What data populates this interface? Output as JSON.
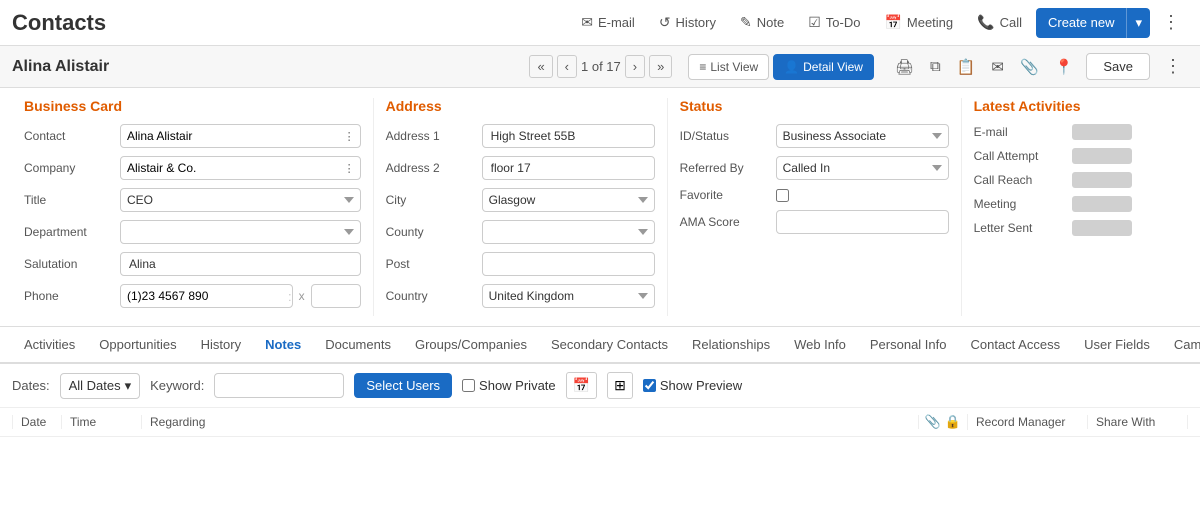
{
  "app": {
    "title": "Contacts"
  },
  "topnav": {
    "email": "E-mail",
    "history": "History",
    "note": "Note",
    "todo": "To-Do",
    "meeting": "Meeting",
    "call": "Call",
    "create_new": "Create new",
    "more_icon": "⋮"
  },
  "record_bar": {
    "name": "Alina Alistair",
    "nav_first": "«",
    "nav_prev": "‹",
    "count": "1 of 17",
    "nav_next": "›",
    "nav_last": "»",
    "list_view": "List View",
    "detail_view": "Detail View",
    "save": "Save",
    "more": "⋮"
  },
  "business_card": {
    "title": "Business Card",
    "fields": [
      {
        "label": "Contact",
        "value": "Alina Alistair",
        "type": "input-btn"
      },
      {
        "label": "Company",
        "value": "Alistair & Co.",
        "type": "input-btn"
      },
      {
        "label": "Title",
        "value": "CEO",
        "type": "select"
      },
      {
        "label": "Department",
        "value": "",
        "type": "select"
      },
      {
        "label": "Salutation",
        "value": "Alina",
        "type": "input"
      },
      {
        "label": "Phone",
        "value": "(1)23 4567 890",
        "type": "phone"
      }
    ]
  },
  "address": {
    "title": "Address",
    "fields": [
      {
        "label": "Address 1",
        "value": "High Street 55B",
        "type": "input"
      },
      {
        "label": "Address 2",
        "value": "floor 17",
        "type": "input"
      },
      {
        "label": "City",
        "value": "Glasgow",
        "type": "select"
      },
      {
        "label": "County",
        "value": "",
        "type": "select"
      },
      {
        "label": "Post",
        "value": "",
        "type": "input"
      },
      {
        "label": "Country",
        "value": "United Kingdom",
        "type": "select"
      }
    ]
  },
  "status": {
    "title": "Status",
    "fields": [
      {
        "label": "ID/Status",
        "value": "Business Associate",
        "type": "select"
      },
      {
        "label": "Referred By",
        "value": "Called In",
        "type": "select"
      },
      {
        "label": "Favorite",
        "value": "",
        "type": "checkbox"
      },
      {
        "label": "AMA Score",
        "value": "",
        "type": "input"
      }
    ]
  },
  "latest_activities": {
    "title": "Latest Activities",
    "items": [
      {
        "label": "E-mail"
      },
      {
        "label": "Call Attempt"
      },
      {
        "label": "Call Reach"
      },
      {
        "label": "Meeting"
      },
      {
        "label": "Letter Sent"
      }
    ]
  },
  "tabs": {
    "items": [
      {
        "label": "Activities",
        "active": false
      },
      {
        "label": "Opportunities",
        "active": false
      },
      {
        "label": "History",
        "active": false
      },
      {
        "label": "Notes",
        "active": true
      },
      {
        "label": "Documents",
        "active": false
      },
      {
        "label": "Groups/Companies",
        "active": false
      },
      {
        "label": "Secondary Contacts",
        "active": false
      },
      {
        "label": "Relationships",
        "active": false
      },
      {
        "label": "Web Info",
        "active": false
      },
      {
        "label": "Personal Info",
        "active": false
      },
      {
        "label": "Contact Access",
        "active": false
      },
      {
        "label": "User Fields",
        "active": false
      },
      {
        "label": "Campaign Re",
        "active": false
      }
    ]
  },
  "notes_toolbar": {
    "dates_label": "Dates:",
    "dates_value": "All Dates",
    "keyword_label": "Keyword:",
    "keyword_placeholder": "",
    "select_users_btn": "Select Users",
    "show_private": "Show Private",
    "show_preview": "Show Preview"
  },
  "table_header": {
    "cols": [
      "Date",
      "Time",
      "Regarding"
    ],
    "record_manager": "Record Manager",
    "share_with": "Share With"
  }
}
